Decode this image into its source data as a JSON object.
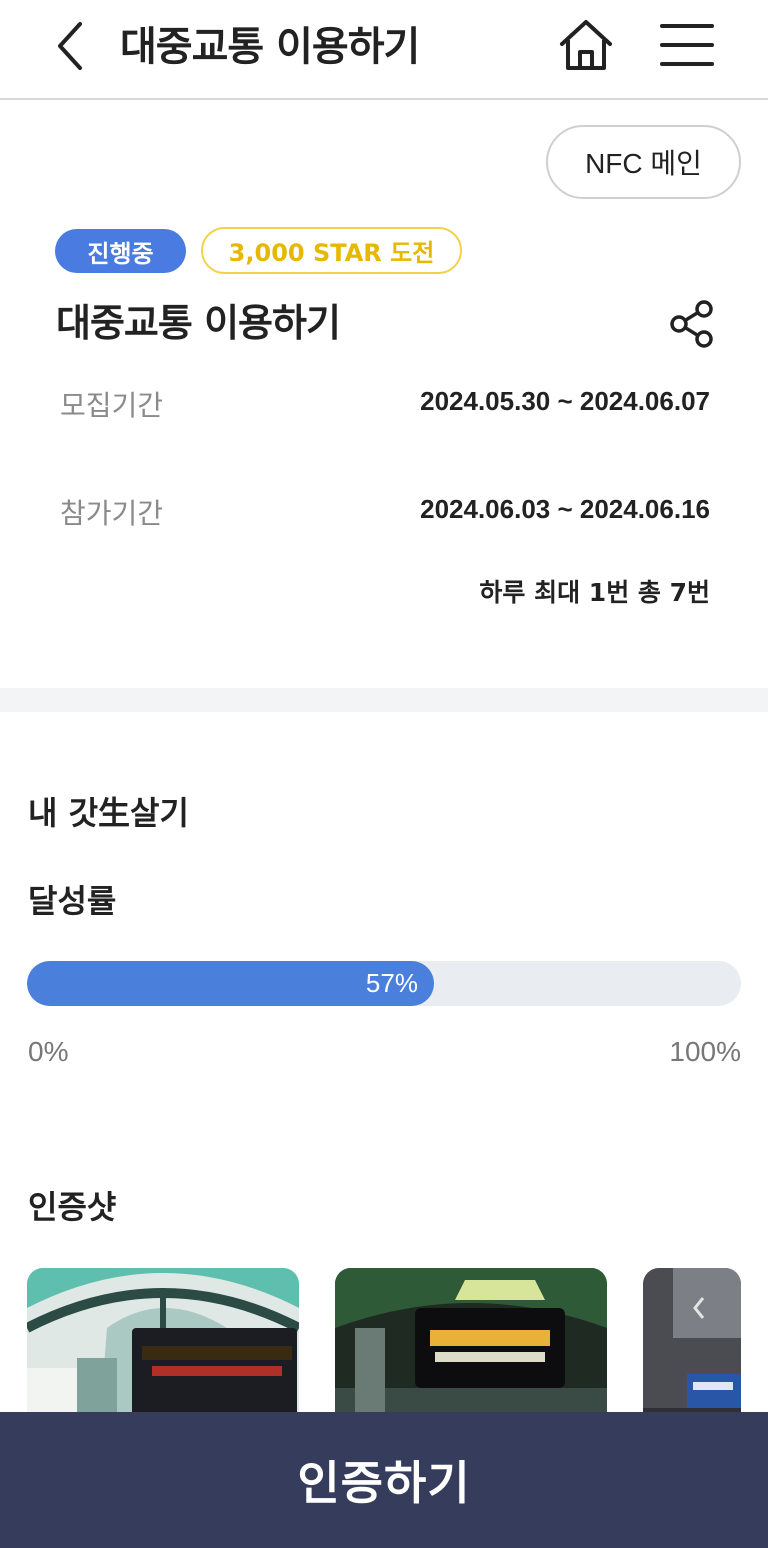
{
  "header": {
    "title": "대중교통 이용하기",
    "icons": {
      "back": "back-arrow-icon",
      "home": "home-icon",
      "menu": "menu-icon"
    }
  },
  "nfc_button": {
    "label": "NFC 메인"
  },
  "event": {
    "status_badge": "진행중",
    "reward_badge": "3,000 STAR 도전",
    "title": "대중교통 이용하기",
    "share_icon": "share-icon",
    "recruit": {
      "label": "모집기간",
      "value": "2024.05.30 ~ 2024.06.07"
    },
    "participate": {
      "label": "참가기간",
      "value": "2024.06.03 ~ 2024.06.16",
      "limit": "하루 최대 1번 총 7번"
    }
  },
  "my_section": {
    "title": "내 갓生살기",
    "progress_title": "달성률",
    "progress_percent": 57,
    "progress_label": "57%",
    "scale_min": "0%",
    "scale_max": "100%"
  },
  "proof_section": {
    "title": "인증샷",
    "photos": [
      "bus-stop-photo",
      "bus-display-photo",
      "street-sign-photo"
    ]
  },
  "cta": {
    "label": "인증하기"
  },
  "colors": {
    "accent_blue": "#4a7be0",
    "star_yellow": "#f2d24b",
    "cta_navy": "#363c5c",
    "progress_track": "#e9edf2"
  }
}
